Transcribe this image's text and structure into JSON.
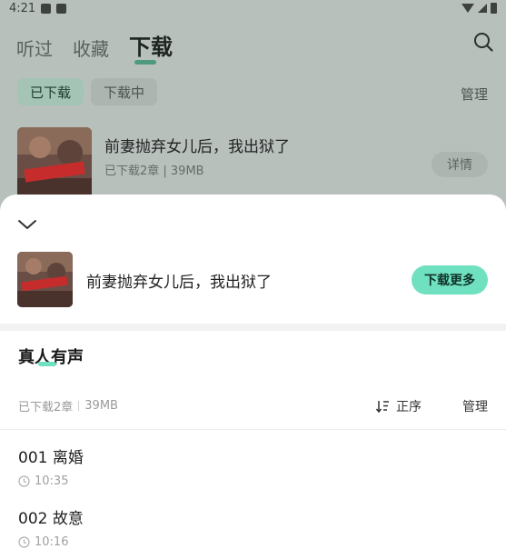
{
  "status_bar": {
    "time": "4:21"
  },
  "top_tabs": [
    {
      "label": "听过"
    },
    {
      "label": "收藏"
    },
    {
      "label": "下载"
    }
  ],
  "sub_tabs": [
    {
      "label": "已下载"
    },
    {
      "label": "下载中"
    }
  ],
  "background": {
    "manage_label": "管理",
    "book": {
      "title": "前妻抛弃女儿后，我出狱了",
      "meta": "已下载2章 | 39MB",
      "detail_label": "详情",
      "cover_text": "前妻抛弃女儿后"
    }
  },
  "sheet": {
    "book_title": "前妻抛弃女儿后，我出狱了",
    "cover_text": "前妻抛弃女儿后",
    "download_more_label": "下载更多",
    "section_title": "真人有声",
    "downloaded_count": "已下载2章",
    "size": "39MB",
    "sort_label": "正序",
    "manage_label": "管理",
    "chapters": [
      {
        "title": "001 离婚",
        "duration": "10:35"
      },
      {
        "title": "002 故意",
        "duration": "10:16"
      }
    ]
  },
  "colors": {
    "accent": "#6fe0c0",
    "overlay_tint": "#b8c0bc"
  }
}
